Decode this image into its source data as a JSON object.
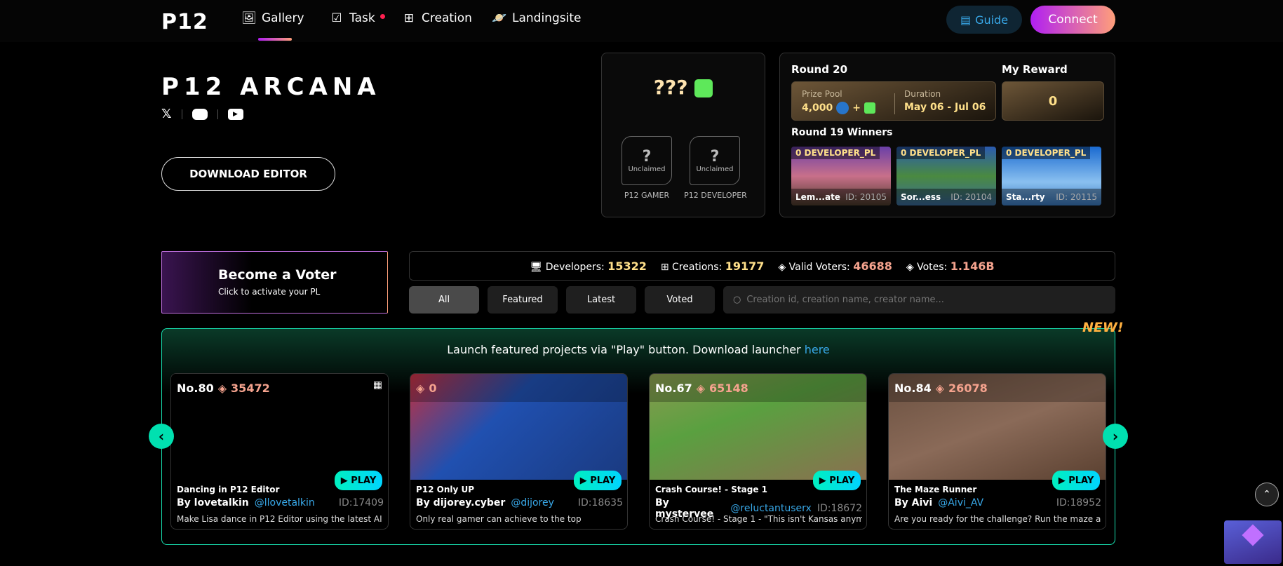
{
  "nav": {
    "logo": "P12",
    "items": [
      {
        "label": "Gallery",
        "icon": "image-icon"
      },
      {
        "label": "Task",
        "icon": "calendar-check-icon"
      },
      {
        "label": "Creation",
        "icon": "file-plus-icon"
      },
      {
        "label": "Landingsite",
        "icon": "planet-icon"
      }
    ],
    "guide": "Guide",
    "connect": "Connect"
  },
  "hero": {
    "title": "P12 ARCANA",
    "download": "DOWNLOAD EDITOR"
  },
  "mystery": {
    "prize": "???",
    "badges": [
      {
        "mark": "?",
        "status": "Unclaimed",
        "label": "P12 GAMER"
      },
      {
        "mark": "?",
        "status": "Unclaimed",
        "label": "P12 DEVELOPER"
      }
    ]
  },
  "round": {
    "title": "Round 20",
    "my_reward_label": "My Reward",
    "prize_pool_label": "Prize Pool",
    "prize_pool": "4,000",
    "plus": "+",
    "duration_label": "Duration",
    "duration": "May 06 - Jul 06",
    "my_reward": "0",
    "winners_title": "Round 19 Winners",
    "winners": [
      {
        "tag": "0 DEVELOPER_PL",
        "name": "Lem...ate",
        "id": "ID: 20105"
      },
      {
        "tag": "0 DEVELOPER_PL",
        "name": "Sor...ess",
        "id": "ID: 20104"
      },
      {
        "tag": "0 DEVELOPER_PL",
        "name": "Sta...rty",
        "id": "ID: 20115"
      }
    ]
  },
  "voter": {
    "title": "Become a Voter",
    "subtitle": "Click to activate your PL"
  },
  "stats": [
    {
      "label": "Developers:",
      "value": "15322",
      "color": "#ffe08a"
    },
    {
      "label": "Creations:",
      "value": "19177",
      "color": "#ffe08a"
    },
    {
      "label": "Valid Voters:",
      "value": "46688",
      "color": "#f5a38e"
    },
    {
      "label": "Votes:",
      "value": "1.146B",
      "color": "#f5a38e"
    }
  ],
  "filters": [
    "All",
    "Featured",
    "Latest",
    "Voted"
  ],
  "search": {
    "placeholder": "Creation id, creation name, creator name..."
  },
  "featured": {
    "new_badge": "NEW!",
    "notice": "Launch featured projects via \"Play\" button. Download launcher ",
    "link": "here",
    "play": "PLAY",
    "cards": [
      {
        "no": "No.80",
        "votes": "35472",
        "title": "Dancing in P12 Editor",
        "by": "By lovetalkin",
        "handle": "@llovetalkin",
        "id": "ID:17409",
        "desc": "Make Lisa dance in P12 Editor using the latest AI"
      },
      {
        "no": "",
        "votes": "0",
        "title": "P12 Only UP",
        "by": "By dijorey.cyber",
        "handle": "@dijorey",
        "id": "ID:18635",
        "desc": "Only real gamer can achieve to the top"
      },
      {
        "no": "No.67",
        "votes": "65148",
        "title": "Crash Course! - Stage 1",
        "by": "By mystervee",
        "handle": "@reluctantuserx",
        "id": "ID:18672",
        "desc": "Crash Course! - Stage 1 - \"This isn't Kansas anym"
      },
      {
        "no": "No.84",
        "votes": "26078",
        "title": "The Maze Runner",
        "by": "By Aivi",
        "handle": "@Aivi_AV",
        "id": "ID:18952",
        "desc": "Are you ready for the challenge? Run the maze a"
      }
    ]
  }
}
